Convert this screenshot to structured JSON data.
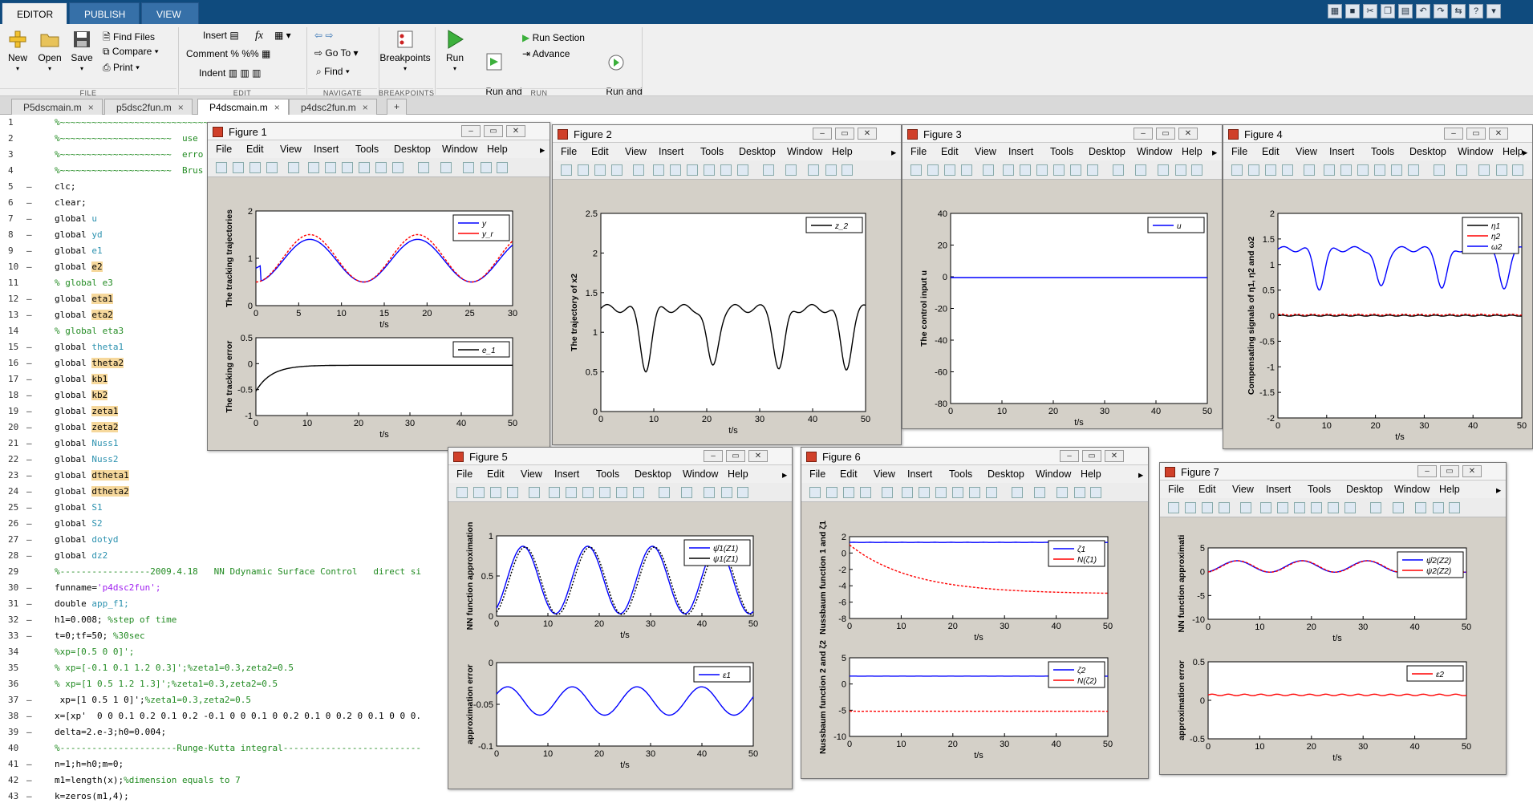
{
  "ribbon_tabs": [
    "EDITOR",
    "PUBLISH",
    "VIEW"
  ],
  "ribbon": {
    "file": {
      "new": "New",
      "open": "Open",
      "save": "Save",
      "find_files": "Find Files",
      "compare": "Compare",
      "print": "Print",
      "group": "FILE"
    },
    "edit": {
      "insert": "Insert",
      "fx": "fx",
      "comment": "Comment",
      "indent": "Indent",
      "group": "EDIT"
    },
    "navigate": {
      "goto": "Go To",
      "find": "Find",
      "group": "NAVIGATE"
    },
    "breakpoints": {
      "label": "Breakpoints",
      "group": "BREAKPOINTS"
    },
    "run": {
      "run": "Run",
      "run_advance": "Run and\nAdvance",
      "run_section": "Run Section",
      "advance": "Advance",
      "run_time": "Run and\nTime",
      "group": "RUN"
    }
  },
  "doc_tabs": [
    "P5dscmain.m",
    "p5dsc2fun.m",
    "P4dscmain.m",
    "p4dsc2fun.m"
  ],
  "new_tab": "+",
  "code": [
    {
      "n": "1",
      "d": "",
      "t": "%~~~~~~~~~~~~~~~~~~~~~~~~~~~~~~~~~~~~~~~~~~~~~~~~~~~~~~~",
      "c": true
    },
    {
      "n": "2",
      "d": "",
      "t": "%~~~~~~~~~~~~~~~~~~~~~  use",
      "c": true
    },
    {
      "n": "3",
      "d": "",
      "t": "%~~~~~~~~~~~~~~~~~~~~~  erro",
      "c": true
    },
    {
      "n": "4",
      "d": "",
      "t": "%~~~~~~~~~~~~~~~~~~~~~  Brus",
      "c": true
    },
    {
      "n": "5",
      "d": "–",
      "t": "clc;"
    },
    {
      "n": "6",
      "d": "–",
      "t": "clear;"
    },
    {
      "n": "7",
      "d": "–",
      "t": "global ",
      "v": "u"
    },
    {
      "n": "8",
      "d": "–",
      "t": "global ",
      "v": "yd"
    },
    {
      "n": "9",
      "d": "–",
      "t": "global ",
      "v": "e1"
    },
    {
      "n": "10",
      "d": "–",
      "t": "global ",
      "h": "e2"
    },
    {
      "n": "11",
      "d": "",
      "t": "% global e3",
      "c": true
    },
    {
      "n": "12",
      "d": "–",
      "t": "global ",
      "h": "eta1"
    },
    {
      "n": "13",
      "d": "–",
      "t": "global ",
      "h": "eta2"
    },
    {
      "n": "14",
      "d": "",
      "t": "% global eta3",
      "c": true
    },
    {
      "n": "15",
      "d": "–",
      "t": "global ",
      "v": "theta1"
    },
    {
      "n": "16",
      "d": "–",
      "t": "global ",
      "h": "theta2"
    },
    {
      "n": "17",
      "d": "–",
      "t": "global ",
      "h": "kb1"
    },
    {
      "n": "18",
      "d": "–",
      "t": "global ",
      "h": "kb2"
    },
    {
      "n": "19",
      "d": "–",
      "t": "global ",
      "h": "zeta1"
    },
    {
      "n": "20",
      "d": "–",
      "t": "global ",
      "h": "zeta2"
    },
    {
      "n": "21",
      "d": "–",
      "t": "global ",
      "v": "Nuss1"
    },
    {
      "n": "22",
      "d": "–",
      "t": "global ",
      "v": "Nuss2"
    },
    {
      "n": "23",
      "d": "–",
      "t": "global ",
      "h": "dtheta1"
    },
    {
      "n": "24",
      "d": "–",
      "t": "global ",
      "h": "dtheta2"
    },
    {
      "n": "25",
      "d": "–",
      "t": "global ",
      "v": "S1"
    },
    {
      "n": "26",
      "d": "–",
      "t": "global ",
      "v": "S2"
    },
    {
      "n": "27",
      "d": "–",
      "t": "global ",
      "v": "dotyd"
    },
    {
      "n": "28",
      "d": "–",
      "t": "global ",
      "v": "dz2"
    },
    {
      "n": "29",
      "d": "",
      "t": "%-----------------2009.4.18   NN Ddynamic Surface Control   direct si",
      "c": true
    },
    {
      "n": "30",
      "d": "–",
      "t": "funname=",
      "s": "'p4dsc2fun';"
    },
    {
      "n": "31",
      "d": "–",
      "t": "double ",
      "v": "app_f1;"
    },
    {
      "n": "32",
      "d": "–",
      "t": "h1=0.008; ",
      "cm": "%step of time"
    },
    {
      "n": "33",
      "d": "–",
      "t": "t=0;tf=50; ",
      "cm": "%30sec"
    },
    {
      "n": "34",
      "d": "",
      "t": "%xp=[0.5 0 0]';",
      "c": true
    },
    {
      "n": "35",
      "d": "",
      "t": "% xp=[-0.1 0.1 1.2 0.3]';%zeta1=0.3,zeta2=0.5",
      "c": true
    },
    {
      "n": "36",
      "d": "",
      "t": "% xp=[1 0.5 1.2 1.3]';%zeta1=0.3,zeta2=0.5",
      "c": true
    },
    {
      "n": "37",
      "d": "–",
      "t": " xp=[1 0.5 1 0]';",
      "cm": "%zeta1=0.3,zeta2=0.5"
    },
    {
      "n": "38",
      "d": "–",
      "t": "x=[xp'  0 0 0.1 0.2 0.1 0.2 -0.1 0 0 0.1 0 0.2 0.1 0 0.2 0 0.1 0 0 0."
    },
    {
      "n": "39",
      "d": "–",
      "t": "delta=2.e-3;h0=0.004;"
    },
    {
      "n": "40",
      "d": "",
      "t": "%----------------------Runge-Kutta integral--------------------------",
      "c": true
    },
    {
      "n": "41",
      "d": "–",
      "t": "n=1;h=h0;m=0;"
    },
    {
      "n": "42",
      "d": "–",
      "t": "m1=length(x);",
      "cm": "%dimension equals to 7"
    },
    {
      "n": "43",
      "d": "–",
      "t": "k=zeros(m1,4);"
    }
  ],
  "figure_menu": [
    "File",
    "Edit",
    "View",
    "Insert",
    "Tools",
    "Desktop",
    "Window",
    "Help"
  ],
  "figures": [
    {
      "title": "Figure 1"
    },
    {
      "title": "Figure 2"
    },
    {
      "title": "Figure 3"
    },
    {
      "title": "Figure 4"
    },
    {
      "title": "Figure 5"
    },
    {
      "title": "Figure 6"
    },
    {
      "title": "Figure 7"
    }
  ],
  "chart_data": [
    {
      "figure": "Figure 1",
      "type": "line",
      "xlabel": "t/s",
      "ylabel": "The tracking trajectories",
      "xlim": [
        0,
        30
      ],
      "ylim": [
        0,
        2
      ],
      "xticks": [
        0,
        5,
        10,
        15,
        20,
        25,
        30
      ],
      "yticks": [
        0,
        1,
        2
      ],
      "legend": [
        "y",
        "y_r"
      ],
      "colors": [
        "#0000ff",
        "#ff0000"
      ],
      "legend_position": "top-right",
      "series": [
        {
          "name": "y",
          "kind": "sine",
          "amp": 0.45,
          "period": 12.6,
          "offset": 0.95,
          "phase": -1.57,
          "start": 0.85
        },
        {
          "name": "y_r",
          "kind": "sine",
          "amp": 0.5,
          "period": 12.6,
          "offset": 1.0,
          "phase": -1.57
        }
      ]
    },
    {
      "figure": "Figure 1",
      "type": "line",
      "xlabel": "t/s",
      "ylabel": "The tracking error",
      "xlim": [
        0,
        50
      ],
      "ylim": [
        -1,
        0.5
      ],
      "xticks": [
        0,
        10,
        20,
        30,
        40,
        50
      ],
      "yticks": [
        -1,
        -0.5,
        0,
        0.5
      ],
      "legend": [
        "e_1"
      ],
      "colors": [
        "#000000"
      ],
      "legend_position": "top-right",
      "series": [
        {
          "name": "e_1",
          "kind": "decay",
          "a0": -0.5,
          "tau": 3,
          "offset": -0.03
        }
      ]
    },
    {
      "figure": "Figure 2",
      "type": "line",
      "xlabel": "t/s",
      "ylabel": "The trajectory of x2",
      "xlim": [
        0,
        50
      ],
      "ylim": [
        0,
        2.5
      ],
      "xticks": [
        0,
        10,
        20,
        30,
        40,
        50
      ],
      "yticks": [
        0,
        0.5,
        1,
        1.5,
        2,
        2.5
      ],
      "legend": [
        "z_2"
      ],
      "colors": [
        "#000000"
      ],
      "legend_position": "top-right",
      "series": [
        {
          "name": "z_2",
          "kind": "dip",
          "base": 1.3,
          "depth": 0.75,
          "period": 12.6,
          "first": 8.5
        }
      ]
    },
    {
      "figure": "Figure 3",
      "type": "line",
      "xlabel": "t/s",
      "ylabel": "The control input u",
      "xlim": [
        0,
        50
      ],
      "ylim": [
        -80,
        40
      ],
      "xticks": [
        0,
        10,
        20,
        30,
        40,
        50
      ],
      "yticks": [
        -80,
        -60,
        -40,
        -20,
        0,
        20,
        40
      ],
      "legend": [
        "u"
      ],
      "colors": [
        "#0000ff"
      ],
      "legend_position": "top-right",
      "series": [
        {
          "name": "u",
          "kind": "flat",
          "value": -0.5
        }
      ]
    },
    {
      "figure": "Figure 4",
      "type": "line",
      "xlabel": "t/s",
      "ylabel": "Compensating signals of η1, η2 and ω2",
      "xlim": [
        0,
        50
      ],
      "ylim": [
        -2,
        2
      ],
      "xticks": [
        0,
        10,
        20,
        30,
        40,
        50
      ],
      "yticks": [
        -2,
        -1.5,
        -1,
        -0.5,
        0,
        0.5,
        1,
        1.5,
        2
      ],
      "legend": [
        "η1",
        "η2",
        "ω2"
      ],
      "colors": [
        "#000000",
        "#ff0000",
        "#0000ff"
      ],
      "legend_position": "top-right",
      "series": [
        {
          "name": "η1",
          "kind": "flat",
          "value": 0
        },
        {
          "name": "η2",
          "kind": "flat",
          "value": 0.02
        },
        {
          "name": "ω2",
          "kind": "dip",
          "base": 1.3,
          "depth": 0.75,
          "period": 12.6,
          "first": 8.5
        }
      ]
    },
    {
      "figure": "Figure 5",
      "type": "line",
      "xlabel": "t/s",
      "ylabel": "NN function approximation",
      "xlim": [
        0,
        50
      ],
      "ylim": [
        0,
        1
      ],
      "xticks": [
        0,
        10,
        20,
        30,
        40,
        50
      ],
      "yticks": [
        0,
        0.5,
        1
      ],
      "legend": [
        "ψ̂1(Z1)",
        "ψ1(Z1)"
      ],
      "colors": [
        "#0000ff",
        "#000000"
      ],
      "legend_position": "top-right",
      "series": [
        {
          "name": "ψ̂1(Z1)",
          "kind": "sine",
          "amp": 0.42,
          "period": 12.6,
          "offset": 0.45,
          "phase": -1.0
        },
        {
          "name": "ψ1(Z1)",
          "kind": "sine",
          "amp": 0.42,
          "period": 12.6,
          "offset": 0.44,
          "phase": -1.2
        }
      ]
    },
    {
      "figure": "Figure 5",
      "type": "line",
      "xlabel": "t/s",
      "ylabel": "approximation error",
      "xlim": [
        0,
        50
      ],
      "ylim": [
        -0.1,
        0
      ],
      "xticks": [
        0,
        10,
        20,
        30,
        40,
        50
      ],
      "yticks": [
        -0.1,
        -0.05,
        0
      ],
      "legend": [
        "ε1"
      ],
      "colors": [
        "#0000ff"
      ],
      "legend_position": "top-right",
      "series": [
        {
          "name": "ε1",
          "kind": "sine",
          "amp": 0.017,
          "period": 12.6,
          "offset": -0.046,
          "phase": 0.5
        }
      ]
    },
    {
      "figure": "Figure 6",
      "type": "line",
      "xlabel": "t/s",
      "ylabel": "Nussbaum function 1 and ζ1",
      "xlim": [
        0,
        50
      ],
      "ylim": [
        -8,
        2
      ],
      "xticks": [
        0,
        10,
        20,
        30,
        40,
        50
      ],
      "yticks": [
        -8,
        -6,
        -4,
        -2,
        0,
        2
      ],
      "legend": [
        "ζ1",
        "N(ζ1)"
      ],
      "colors": [
        "#0000ff",
        "#ff0000"
      ],
      "legend_position": "top-right",
      "series": [
        {
          "name": "ζ1",
          "kind": "flat",
          "value": 1.3
        },
        {
          "name": "N(ζ1)",
          "kind": "decay",
          "a0": 1.0,
          "tau": -1,
          "offset": -5.0
        }
      ]
    },
    {
      "figure": "Figure 6",
      "type": "line",
      "xlabel": "t/s",
      "ylabel": "Nussbaum function 2 and ζ2",
      "xlim": [
        0,
        50
      ],
      "ylim": [
        -10,
        5
      ],
      "xticks": [
        0,
        10,
        20,
        30,
        40,
        50
      ],
      "yticks": [
        -10,
        -5,
        0,
        5
      ],
      "legend": [
        "ζ2",
        "N(ζ2)"
      ],
      "colors": [
        "#0000ff",
        "#ff0000"
      ],
      "legend_position": "top-right",
      "series": [
        {
          "name": "ζ2",
          "kind": "flat",
          "value": 1.5
        },
        {
          "name": "N(ζ2)",
          "kind": "flat",
          "value": -5.2
        }
      ]
    },
    {
      "figure": "Figure 7",
      "type": "line",
      "xlabel": "t/s",
      "ylabel": "NN function approximati",
      "xlim": [
        0,
        50
      ],
      "ylim": [
        -10,
        5
      ],
      "xticks": [
        0,
        10,
        20,
        30,
        40,
        50
      ],
      "yticks": [
        -10,
        -5,
        0,
        5
      ],
      "legend": [
        "ψ̂2(Z2)",
        "ψ2(Z2)"
      ],
      "colors": [
        "#0000ff",
        "#ff0000"
      ],
      "legend_position": "top-right",
      "series": [
        {
          "name": "ψ̂2(Z2)",
          "kind": "sine",
          "amp": 1.2,
          "period": 12.6,
          "offset": 1.1,
          "phase": -1.2
        },
        {
          "name": "ψ2(Z2)",
          "kind": "sine",
          "amp": 1.2,
          "period": 12.6,
          "offset": 1.1,
          "phase": -1.3
        }
      ]
    },
    {
      "figure": "Figure 7",
      "type": "line",
      "xlabel": "t/s",
      "ylabel": "approximation error",
      "xlim": [
        0,
        50
      ],
      "ylim": [
        -0.5,
        0.5
      ],
      "xticks": [
        0,
        10,
        20,
        30,
        40,
        50
      ],
      "yticks": [
        -0.5,
        0,
        0.5
      ],
      "legend": [
        "ε2"
      ],
      "colors": [
        "#ff0000"
      ],
      "legend_position": "top-right",
      "series": [
        {
          "name": "ε2",
          "kind": "flat",
          "value": 0.07
        }
      ]
    }
  ]
}
